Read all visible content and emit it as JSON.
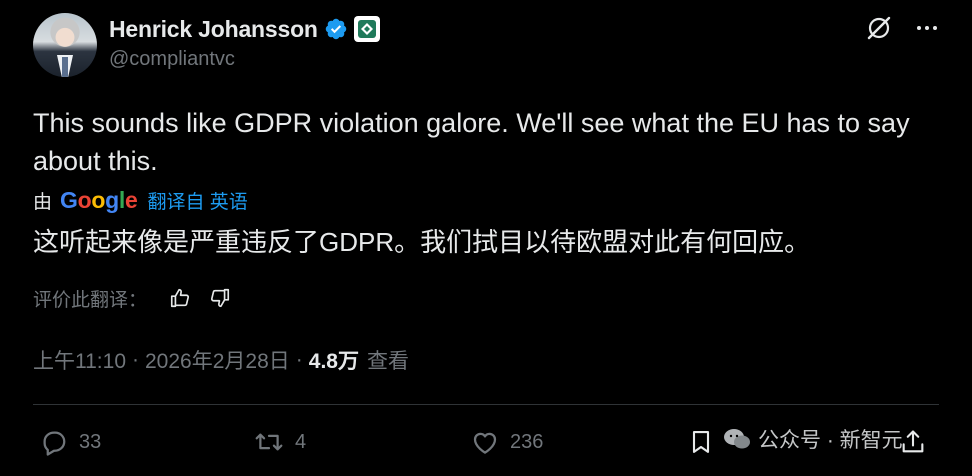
{
  "author": {
    "name": "Henrick Johansson",
    "handle": "@compliantvc"
  },
  "tweet": {
    "text": "This sounds like GDPR violation galore. We'll see what the EU has to say about this.",
    "translation": {
      "by_label": "由",
      "provider": "Google",
      "link_label": "翻译自 英语",
      "text": "这听起来像是严重违反了GDPR。我们拭目以待欧盟对此有何回应。",
      "rate_label": "评价此翻译："
    },
    "time": "上午11:10",
    "separator": "·",
    "date": "2026年2月28日",
    "views_count": "4.8万",
    "views_label": "查看"
  },
  "actions": {
    "replies": "33",
    "reposts": "4",
    "likes": "236"
  },
  "watermark": {
    "text": "公众号 · 新智元"
  },
  "colors": {
    "background": "#000000",
    "text": "#e7e9ea",
    "muted": "#71767b",
    "accent": "#1d9bf0"
  },
  "icons": [
    "verified-badge-icon",
    "affiliate-badge-icon",
    "grok-icon",
    "more-icon",
    "thumbs-up-icon",
    "thumbs-down-icon",
    "reply-icon",
    "repost-icon",
    "like-icon",
    "bookmark-icon",
    "share-icon",
    "wechat-icon"
  ]
}
